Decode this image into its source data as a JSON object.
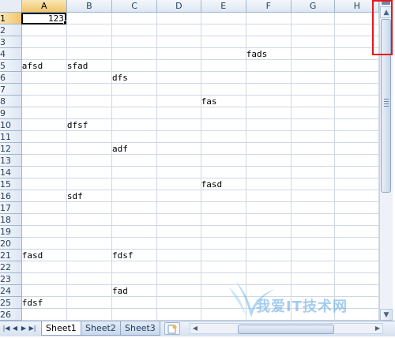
{
  "columns": [
    "A",
    "B",
    "C",
    "D",
    "E",
    "F",
    "G",
    "H"
  ],
  "rows": [
    "1",
    "2",
    "3",
    "4",
    "5",
    "6",
    "7",
    "8",
    "9",
    "10",
    "11",
    "12",
    "13",
    "14",
    "15",
    "16",
    "17",
    "18",
    "19",
    "20",
    "21",
    "22",
    "23",
    "24",
    "25",
    "26"
  ],
  "cells": {
    "1": {
      "A": "123"
    },
    "4": {
      "F": "fads"
    },
    "5": {
      "A": "afsd",
      "B": "sfad"
    },
    "6": {
      "C": "dfs"
    },
    "8": {
      "E": "fas"
    },
    "10": {
      "B": "dfsf"
    },
    "12": {
      "C": "adf"
    },
    "15": {
      "E": "fasd"
    },
    "16": {
      "B": "sdf"
    },
    "21": {
      "A": "fasd",
      "C": "fdsf"
    },
    "24": {
      "C": "fad"
    },
    "25": {
      "A": "fdsf"
    }
  },
  "selected_cell": "A1",
  "sheet_tabs": [
    "Sheet1",
    "Sheet2",
    "Sheet3"
  ],
  "active_sheet": "Sheet1",
  "colors": {
    "highlight_box": "#e8141b",
    "header_bg": "#dde7f3",
    "gridline": "#d0d7e5"
  },
  "icons": {
    "nav": [
      "first-sheet-icon",
      "prev-sheet-icon",
      "next-sheet-icon",
      "last-sheet-icon"
    ],
    "scroll": [
      "split-box-icon",
      "scroll-up-icon",
      "scroll-down-icon",
      "scroll-left-icon",
      "scroll-right-icon"
    ]
  },
  "watermark": {
    "text": "我爱IT技术网"
  }
}
